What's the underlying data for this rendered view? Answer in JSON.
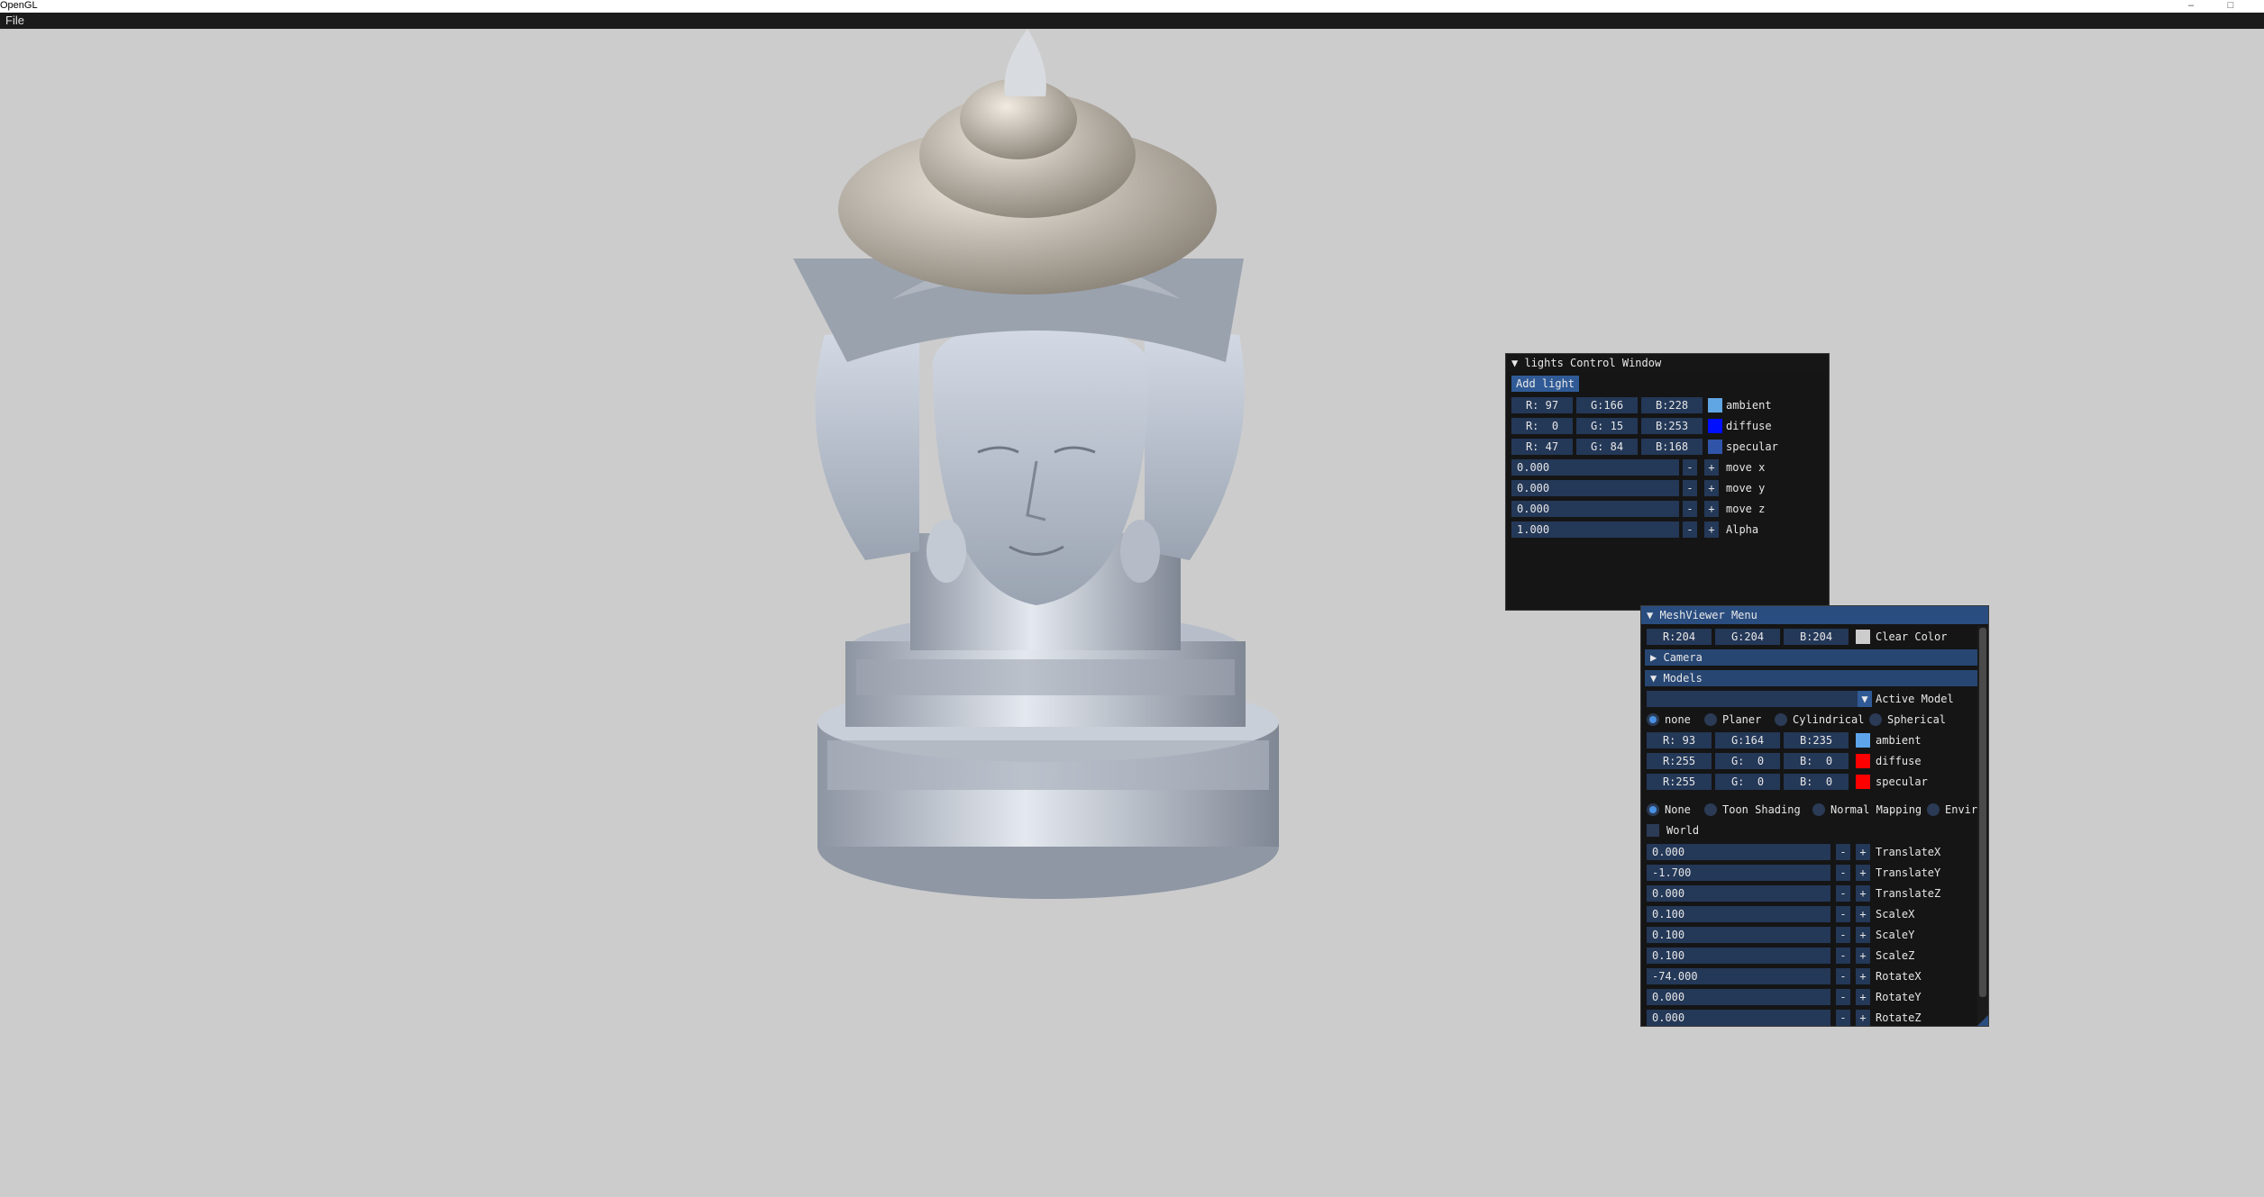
{
  "window": {
    "title": "OpenGL",
    "minimize_glyph": "–",
    "maximize_glyph": "□"
  },
  "menubar": {
    "file_label": "File"
  },
  "lights_window": {
    "title": "lights Control Window",
    "add_light_label": "Add light",
    "colors": [
      {
        "r": "R: 97",
        "g": "G:166",
        "b": "B:228",
        "label": "ambient",
        "swatch": "#61a6e4"
      },
      {
        "r": "R:  0",
        "g": "G: 15",
        "b": "B:253",
        "label": "diffuse",
        "swatch": "#000ffd"
      },
      {
        "r": "R: 47",
        "g": "G: 84",
        "b": "B:168",
        "label": "specular",
        "swatch": "#2f54a8"
      }
    ],
    "sliders": [
      {
        "value": "0.000",
        "label": "move x"
      },
      {
        "value": "0.000",
        "label": "move y"
      },
      {
        "value": "0.000",
        "label": "move z"
      },
      {
        "value": "1.000",
        "label": "Alpha"
      }
    ]
  },
  "mesh_window": {
    "title": "MeshViewer Menu",
    "clear_color": {
      "r": "R:204",
      "g": "G:204",
      "b": "B:204",
      "label": "Clear Color",
      "swatch": "#cccccc"
    },
    "camera_header": "Camera",
    "models_header": "Models",
    "active_model": {
      "value": "",
      "label": "Active Model"
    },
    "mapping_options": [
      {
        "label": "none",
        "selected": true
      },
      {
        "label": "Planer",
        "selected": false
      },
      {
        "label": "Cylindrical",
        "selected": false
      },
      {
        "label": "Spherical",
        "selected": false
      }
    ],
    "colors": [
      {
        "r": "R: 93",
        "g": "G:164",
        "b": "B:235",
        "label": "ambient",
        "swatch": "#5da4eb"
      },
      {
        "r": "R:255",
        "g": "G:  0",
        "b": "B:  0",
        "label": "diffuse",
        "swatch": "#ff0000"
      },
      {
        "r": "R:255",
        "g": "G:  0",
        "b": "B:  0",
        "label": "specular",
        "swatch": "#ff0000"
      }
    ],
    "shading_options": [
      {
        "label": "None",
        "selected": true
      },
      {
        "label": "Toon Shading",
        "selected": false
      },
      {
        "label": "Normal Mapping",
        "selected": false
      },
      {
        "label": "Envir",
        "selected": false
      }
    ],
    "world_label": "World",
    "transforms": [
      {
        "value": "0.000",
        "label": "TranslateX"
      },
      {
        "value": "-1.700",
        "label": "TranslateY"
      },
      {
        "value": "0.000",
        "label": "TranslateZ"
      },
      {
        "value": "0.100",
        "label": "ScaleX"
      },
      {
        "value": "0.100",
        "label": "ScaleY"
      },
      {
        "value": "0.100",
        "label": "ScaleZ"
      },
      {
        "value": "-74.000",
        "label": "RotateX"
      },
      {
        "value": "0.000",
        "label": "RotateY"
      },
      {
        "value": "0.000",
        "label": "RotateZ"
      }
    ]
  },
  "glyphs": {
    "expanded": "▼",
    "collapsed": "▶",
    "minus": "-",
    "plus": "+"
  },
  "colors": {
    "viewport_bg": "#cccccc",
    "accent": "#2f5a96",
    "title_active": "#2a4d80"
  }
}
